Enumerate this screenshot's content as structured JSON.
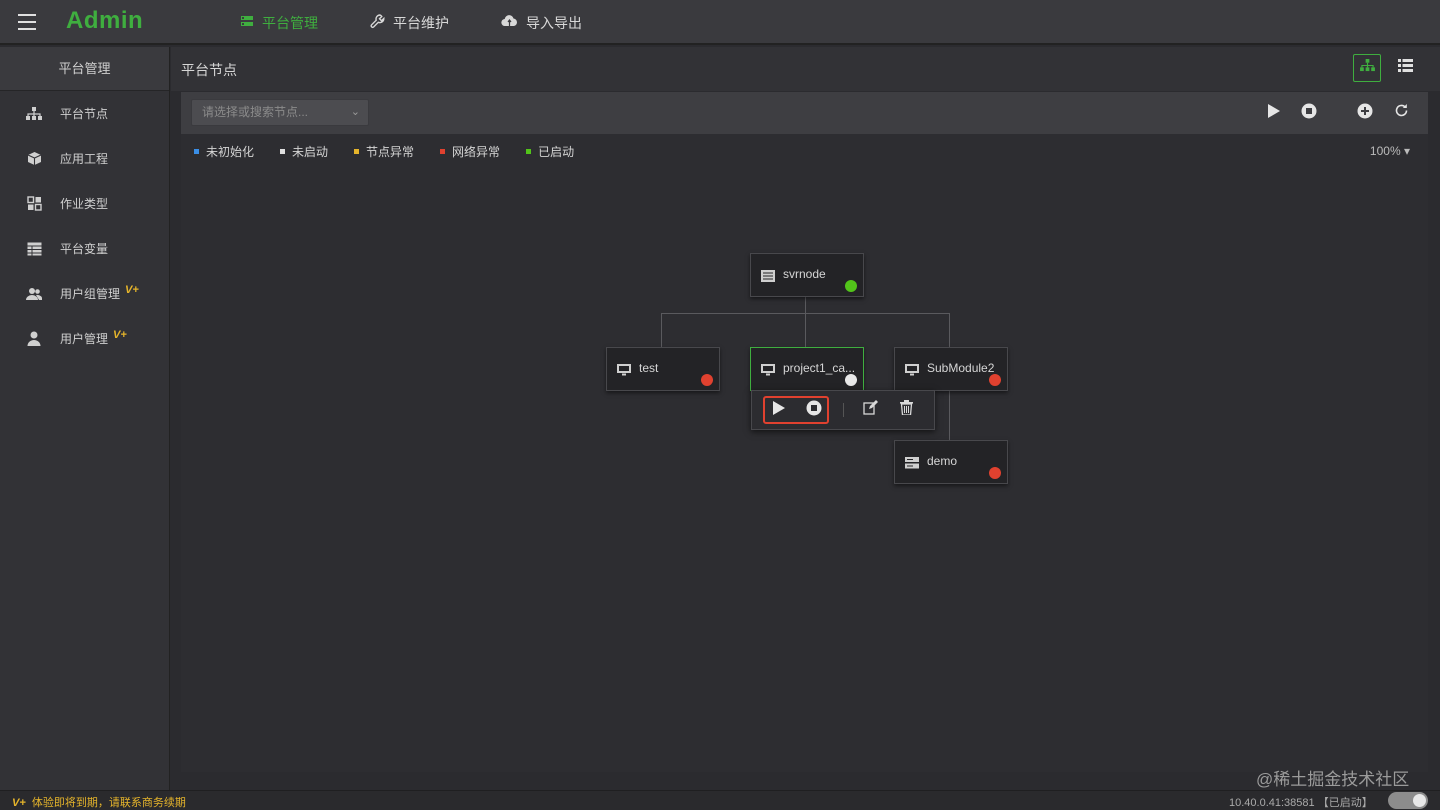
{
  "app": {
    "brand": "Admin"
  },
  "topnav": [
    {
      "label": "平台管理",
      "icon": "server-icon",
      "active": true
    },
    {
      "label": "平台维护",
      "icon": "wrench-icon",
      "active": false
    },
    {
      "label": "导入导出",
      "icon": "cloud-transfer-icon",
      "active": false
    }
  ],
  "sidebar": {
    "header": "平台管理",
    "items": [
      {
        "label": "平台节点",
        "icon": "sitemap-icon",
        "vplus": ""
      },
      {
        "label": "应用工程",
        "icon": "cube-icon",
        "vplus": ""
      },
      {
        "label": "作业类型",
        "icon": "grid-icon",
        "vplus": ""
      },
      {
        "label": "平台变量",
        "icon": "table-icon",
        "vplus": ""
      },
      {
        "label": "用户组管理",
        "icon": "users-icon",
        "vplus": "V+"
      },
      {
        "label": "用户管理",
        "icon": "user-icon",
        "vplus": "V+"
      }
    ]
  },
  "main": {
    "title": "平台节点",
    "search": {
      "placeholder": "请选择或搜索节点..."
    },
    "zoom": "100%",
    "legend": [
      {
        "label": "未初始化",
        "color": "#3a8ee6"
      },
      {
        "label": "未启动",
        "color": "#e0e0e0"
      },
      {
        "label": "节点异常",
        "color": "#e5b42b"
      },
      {
        "label": "网络异常",
        "color": "#e0412f"
      },
      {
        "label": "已启动",
        "color": "#52c41a"
      }
    ],
    "nodes": {
      "svrnode": {
        "label": "svrnode",
        "status_color": "#52c41a"
      },
      "test": {
        "label": "test",
        "status_color": "#e0412f"
      },
      "project1": {
        "label": "project1_ca...",
        "status_color": "#e8e8e8"
      },
      "submodule2": {
        "label": "SubModule2",
        "status_color": "#e0412f"
      },
      "demo": {
        "label": "demo",
        "status_color": "#e0412f"
      }
    }
  },
  "statusbar": {
    "vplus": "V+",
    "warning": "体验即将到期，请联系商务续期",
    "ip": "10.40.0.41:38581 【已启动】"
  },
  "watermark": "@稀土掘金技术社区"
}
